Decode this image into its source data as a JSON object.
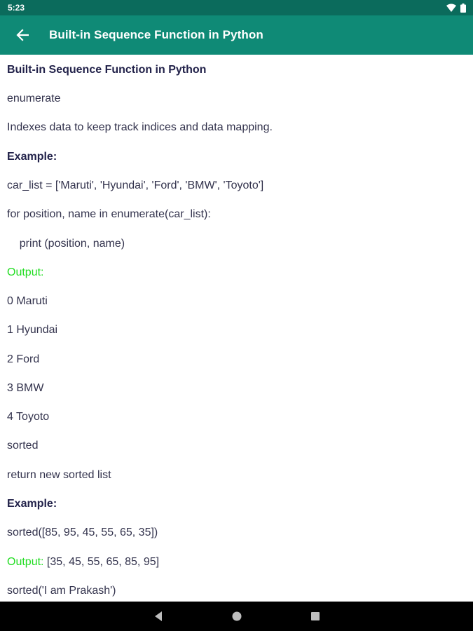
{
  "status_bar": {
    "time": "5:23"
  },
  "app_bar": {
    "title": "Built-in Sequence Function in Python",
    "back_icon": "arrow-left-icon"
  },
  "content": {
    "title": "Built-in Sequence Function in Python",
    "enumerate_name": "enumerate",
    "enumerate_desc": "Indexes data to keep track indices and data mapping.",
    "example1_label": "Example:",
    "code1_line1": "car_list = ['Maruti', 'Hyundai', 'Ford', 'BMW', 'Toyoto']",
    "code1_line2": "for position, name in enumerate(car_list):",
    "code1_line3": "    print (position, name)",
    "output1_label": "Output:",
    "output1_lines": [
      "0 Maruti",
      "1 Hyundai",
      "2 Ford",
      "3 BMW",
      "4 Toyoto"
    ],
    "sorted_name": "sorted",
    "sorted_desc": "return new sorted list",
    "example2_label": "Example:",
    "code2_line1": "sorted([85, 95, 45, 55, 65, 35])",
    "output2_label": "Output:",
    "output2_value": " [35, 45, 55, 65, 85, 95]",
    "code2_line2": "sorted('I am Prakash')"
  },
  "colors": {
    "app_bar": "#0f8a76",
    "status_bar": "#0b6b5c",
    "output_green": "#22dd22",
    "text": "#33334d"
  }
}
